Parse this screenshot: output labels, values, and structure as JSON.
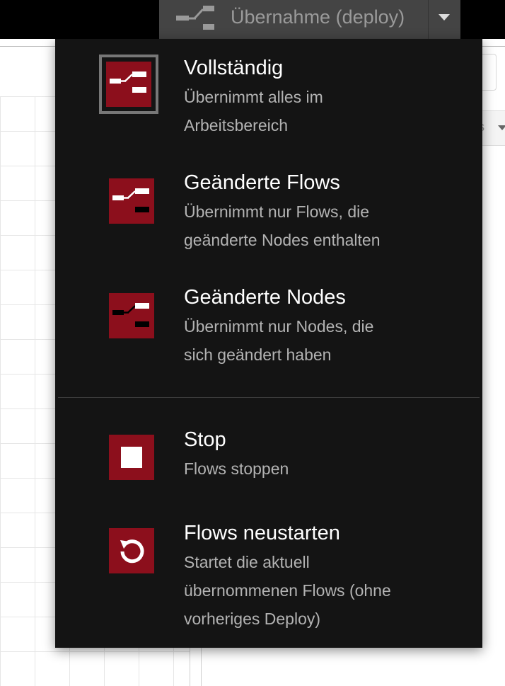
{
  "header": {
    "deploy_button": {
      "label": "Übernahme (deploy)",
      "icon": "deploy-icon"
    },
    "dropdown_toggle": {
      "icon": "caret-down-icon"
    }
  },
  "workspace": {
    "side_field_text": "s"
  },
  "deploy_menu": {
    "items": [
      {
        "title": "Vollständig",
        "description": [
          "Übernimmt alles im",
          "Arbeitsbereich"
        ],
        "icon": "deploy-full-icon",
        "selected": true
      },
      {
        "title": "Geänderte Flows",
        "description": [
          "Übernimmt nur Flows, die",
          "geänderte Nodes enthalten"
        ],
        "icon": "deploy-flows-icon",
        "selected": false
      },
      {
        "title": "Geänderte Nodes",
        "description": [
          "Übernimmt nur Nodes, die",
          "sich geändert haben"
        ],
        "icon": "deploy-nodes-icon",
        "selected": false
      },
      {
        "title": "Stop",
        "description": [
          "Flows stoppen"
        ],
        "icon": "stop-icon",
        "selected": false
      },
      {
        "title": "Flows neustarten",
        "description": [
          "Startet die aktuell",
          "übernommenen Flows (ohne",
          "vorheriges Deploy)"
        ],
        "icon": "restart-icon",
        "selected": false
      }
    ]
  },
  "colors": {
    "menu_background": "#141414",
    "icon_red": "#8c0f1c",
    "selected_border": "#777777",
    "title_text": "#ffffff",
    "description_text": "#b3b3b3"
  }
}
